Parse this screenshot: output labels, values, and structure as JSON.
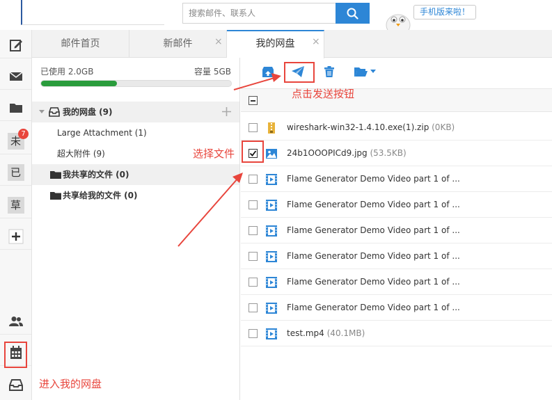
{
  "header": {
    "search_placeholder": "搜索邮件、联系人",
    "mobile_bubble": "手机版来啦！"
  },
  "rail": {
    "unread_badge": "7",
    "items": [
      "compose-icon",
      "inbox-icon",
      "folder-icon",
      "未",
      "已",
      "草",
      "plus-icon",
      "contacts-icon",
      "calendar-icon",
      "netdisk-icon"
    ],
    "letters": {
      "unread": "未",
      "sent": "已",
      "draft": "草"
    }
  },
  "tabs": [
    {
      "label": "邮件首页"
    },
    {
      "label": "新邮件"
    },
    {
      "label": "我的网盘"
    }
  ],
  "disk": {
    "used": "已使用 2.0GB",
    "capacity": "容量 5GB",
    "used_fraction": 0.4,
    "tree": [
      {
        "label": "我的网盘 (9)"
      },
      {
        "label": "Large Attachment (1)"
      },
      {
        "label": "超大附件 (9)"
      },
      {
        "label": "我共享的文件 (0)"
      },
      {
        "label": "共享给我的文件 (0)"
      }
    ]
  },
  "files": [
    {
      "name": "wireshark-win32-1.4.10.exe(1).zip",
      "size": " (0KB)",
      "icon": "zip-icon",
      "checked": false
    },
    {
      "name": "24b1OOOPICd9.jpg",
      "size": " (53.5KB)",
      "icon": "image-icon",
      "checked": true
    },
    {
      "name": "Flame Generator Demo Video part 1 of ...",
      "size": "",
      "icon": "video-icon",
      "checked": false
    },
    {
      "name": "Flame Generator Demo Video part 1 of ...",
      "size": "",
      "icon": "video-icon",
      "checked": false
    },
    {
      "name": "Flame Generator Demo Video part 1 of ...",
      "size": "",
      "icon": "video-icon",
      "checked": false
    },
    {
      "name": "Flame Generator Demo Video part 1 of ...",
      "size": "",
      "icon": "video-icon",
      "checked": false
    },
    {
      "name": "Flame Generator Demo Video part 1 of ...",
      "size": "",
      "icon": "video-icon",
      "checked": false
    },
    {
      "name": "Flame Generator Demo Video part 1 of ...",
      "size": "",
      "icon": "video-icon",
      "checked": false
    },
    {
      "name": "test.mp4",
      "size": " (40.1MB)",
      "icon": "video-icon",
      "checked": false
    }
  ],
  "annotations": {
    "send_tip": "点击发送按钮",
    "select_tip": "选择文件",
    "enter_tip": "进入我的网盘"
  },
  "colors": {
    "accent": "#2d86d6",
    "annotation": "#e8453c",
    "usage_fill": "#2a9c3c"
  }
}
